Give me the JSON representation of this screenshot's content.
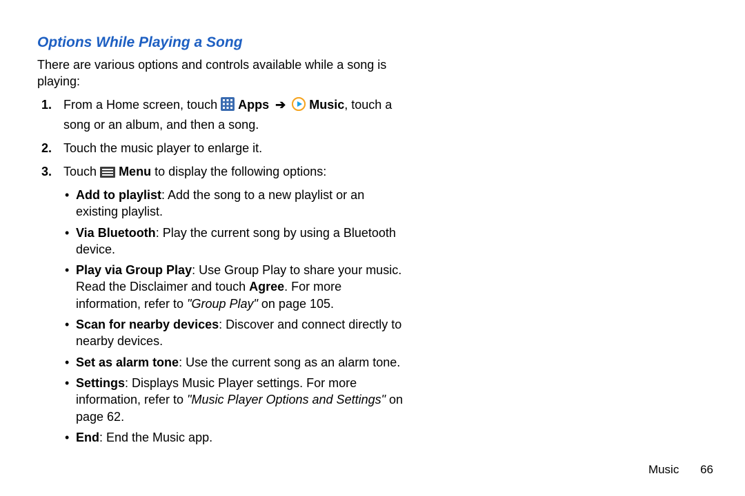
{
  "title": "Options While Playing a Song",
  "intro": "There are various options and controls available while a song is playing:",
  "steps": {
    "s1": {
      "num": "1.",
      "pre": "From a Home screen, touch ",
      "apps": "Apps",
      "arrow": "➔",
      "music": "Music",
      "post": ", touch a song or an album, and then a song."
    },
    "s2": {
      "num": "2.",
      "text": "Touch the music player to enlarge it."
    },
    "s3": {
      "num": "3.",
      "pre": "Touch ",
      "menu": "Menu",
      "post": " to display the following options:"
    }
  },
  "bullets": {
    "b1": {
      "label": "Add to playlist",
      "text": ": Add the song to a new playlist or an existing playlist."
    },
    "b2": {
      "label": "Via Bluetooth",
      "text": ": Play the current song by using a Bluetooth device."
    },
    "b3": {
      "label": "Play via Group Play",
      "text_a": ": Use Group Play to share your music. Read the Disclaimer and touch ",
      "agree": "Agree",
      "text_b": ". For more information, refer to ",
      "ref": "\"Group Play\"",
      "text_c": " on page 105."
    },
    "b4": {
      "label": "Scan for nearby devices",
      "text": ": Discover and connect directly to nearby devices."
    },
    "b5": {
      "label": "Set as alarm tone",
      "text": ": Use the current song as an alarm tone."
    },
    "b6": {
      "label": "Settings",
      "text_a": ": Displays Music Player settings. For more information, refer to ",
      "ref": "\"Music Player Options and Settings\"",
      "text_b": " on page 62."
    },
    "b7": {
      "label": "End",
      "text": ": End the Music app."
    }
  },
  "footer": {
    "section": "Music",
    "page": "66"
  }
}
